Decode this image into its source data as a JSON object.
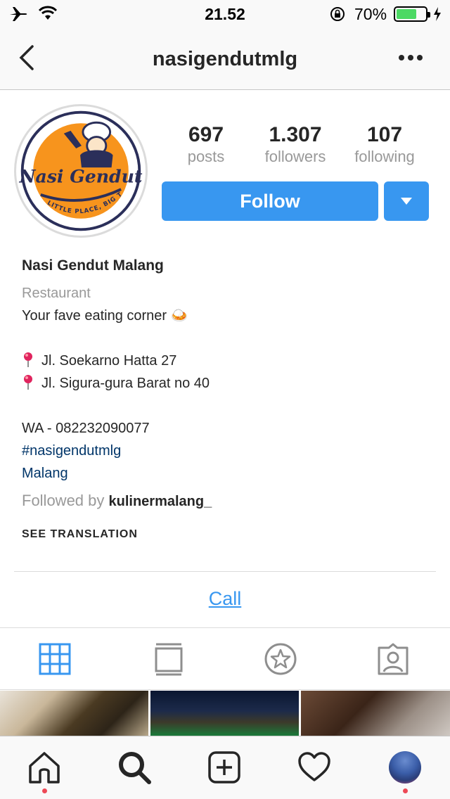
{
  "status_bar": {
    "time": "21.52",
    "battery_percent": "70%",
    "battery_level": 0.7,
    "icons": [
      "airplane-icon",
      "wifi-icon",
      "orientation-lock-icon",
      "battery-icon",
      "charging-bolt-icon"
    ]
  },
  "nav": {
    "title": "nasigendutmlg",
    "back_icon": "chevron-left-icon",
    "more_icon": "more-dots-icon"
  },
  "profile": {
    "avatar_icon": "nasi-gendut-logo",
    "avatar_logo_text": "Nasi Gendut",
    "avatar_tagline": "LITTLE PLACE, BIG TASTE",
    "stats": [
      {
        "value": "697",
        "label": "posts"
      },
      {
        "value": "1.307",
        "label": "followers"
      },
      {
        "value": "107",
        "label": "following"
      }
    ],
    "follow_label": "Follow",
    "follow_color": "#3897f0"
  },
  "bio": {
    "name": "Nasi Gendut Malang",
    "category": "Restaurant",
    "tagline": "Your fave eating corner 🍛",
    "address_1": "Jl. Soekarno Hatta 27",
    "address_2": "Jl. Sigura-gura Barat no 40",
    "phone": "WA - 082232090077",
    "hashtag": "#nasigendutmlg",
    "city": "Malang",
    "followed_by_prefix": "Followed by",
    "followed_by_user": "kulinermalang_",
    "see_translation": "SEE TRANSLATION"
  },
  "actions": {
    "call_label": "Call"
  },
  "tabs": [
    {
      "icon": "grid-icon",
      "active": true
    },
    {
      "icon": "feed-list-icon",
      "active": false
    },
    {
      "icon": "star-icon",
      "active": false
    },
    {
      "icon": "tagged-user-icon",
      "active": false
    }
  ],
  "bottom_nav": [
    {
      "icon": "home-icon",
      "has_dot": true
    },
    {
      "icon": "search-icon",
      "has_dot": false
    },
    {
      "icon": "add-post-icon",
      "has_dot": false
    },
    {
      "icon": "heart-icon",
      "has_dot": false
    },
    {
      "icon": "profile-avatar",
      "has_dot": true
    }
  ],
  "colors": {
    "accent": "#3897f0",
    "hashtag": "#003569",
    "muted": "#999999",
    "notification_dot": "#ed4956"
  }
}
